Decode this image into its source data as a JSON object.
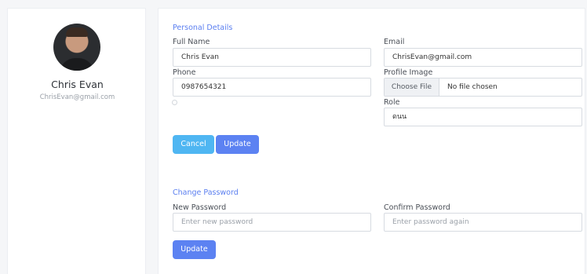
{
  "profile": {
    "name": "Chris Evan",
    "email": "ChrisEvan@gmail.com"
  },
  "personal_details": {
    "title": "Personal Details",
    "full_name_label": "Full Name",
    "full_name_value": "Chris Evan",
    "email_label": "Email",
    "email_value": "ChrisEvan@gmail.com",
    "phone_label": "Phone",
    "phone_value": "0987654321",
    "profile_image_label": "Profile Image",
    "choose_file_label": "Choose File",
    "file_status": "No file chosen",
    "role_label": "Role",
    "role_value": "ดนน",
    "cancel_label": "Cancel",
    "update_label": "Update"
  },
  "change_password": {
    "title": "Change Password",
    "new_password_label": "New Password",
    "new_password_placeholder": "Enter new password",
    "confirm_password_label": "Confirm Password",
    "confirm_password_placeholder": "Enter password again",
    "update_label": "Update"
  },
  "colors": {
    "accent": "#5c82f2",
    "cancel": "#4fb6f2",
    "section_title": "#5b7ff0"
  }
}
